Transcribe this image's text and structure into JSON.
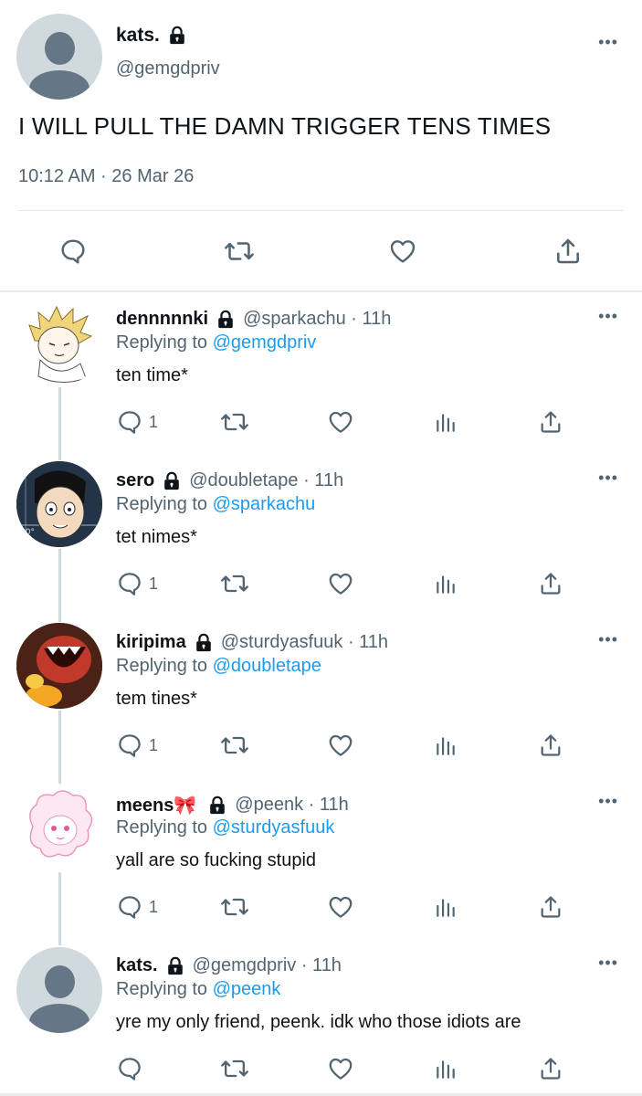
{
  "main_tweet": {
    "display_name": "kats.",
    "handle": "@gemgdpriv",
    "text": "I WILL PULL THE DAMN TRIGGER TENS TIMES",
    "timestamp": "10:12 AM · 26 Mar 26",
    "more": "•••"
  },
  "replies": [
    {
      "display_name": "dennnnnki",
      "handle": "@sparkachu · 11h",
      "replying_prefix": "Replying to ",
      "replying_to": "@gemgdpriv",
      "text": "ten time*",
      "reply_count": "1",
      "more": "•••"
    },
    {
      "display_name": "sero",
      "handle": "@doubletape · 11h",
      "replying_prefix": "Replying to ",
      "replying_to": "@sparkachu",
      "text": "tet nimes*",
      "reply_count": "1",
      "more": "•••"
    },
    {
      "display_name": "kiripima",
      "handle": "@sturdyasfuuk · 11h",
      "replying_prefix": "Replying to ",
      "replying_to": "@doubletape",
      "text": "tem tines*",
      "reply_count": "1",
      "more": "•••"
    },
    {
      "display_name": "meens🎀",
      "handle": "@peenk · 11h",
      "replying_prefix": "Replying to ",
      "replying_to": "@sturdyasfuuk",
      "text": "yall are so fucking stupid",
      "reply_count": "1",
      "more": "•••"
    },
    {
      "display_name": "kats.",
      "handle": "@gemgdpriv · 11h",
      "replying_prefix": "Replying to ",
      "replying_to": "@peenk",
      "text": "yre my only friend, peenk. idk who those idiots are",
      "reply_count": "",
      "more": "•••"
    }
  ],
  "colors": {
    "link": "#1d9bf0",
    "secondary_text": "#536471",
    "primary_text": "#0f1419",
    "divider": "#e7ecf0"
  },
  "icons": {
    "reply": "speech-bubble-icon",
    "retweet": "retweet-icon",
    "like": "heart-icon",
    "views": "bar-chart-icon",
    "share": "share-icon",
    "lock": "lock-icon"
  }
}
